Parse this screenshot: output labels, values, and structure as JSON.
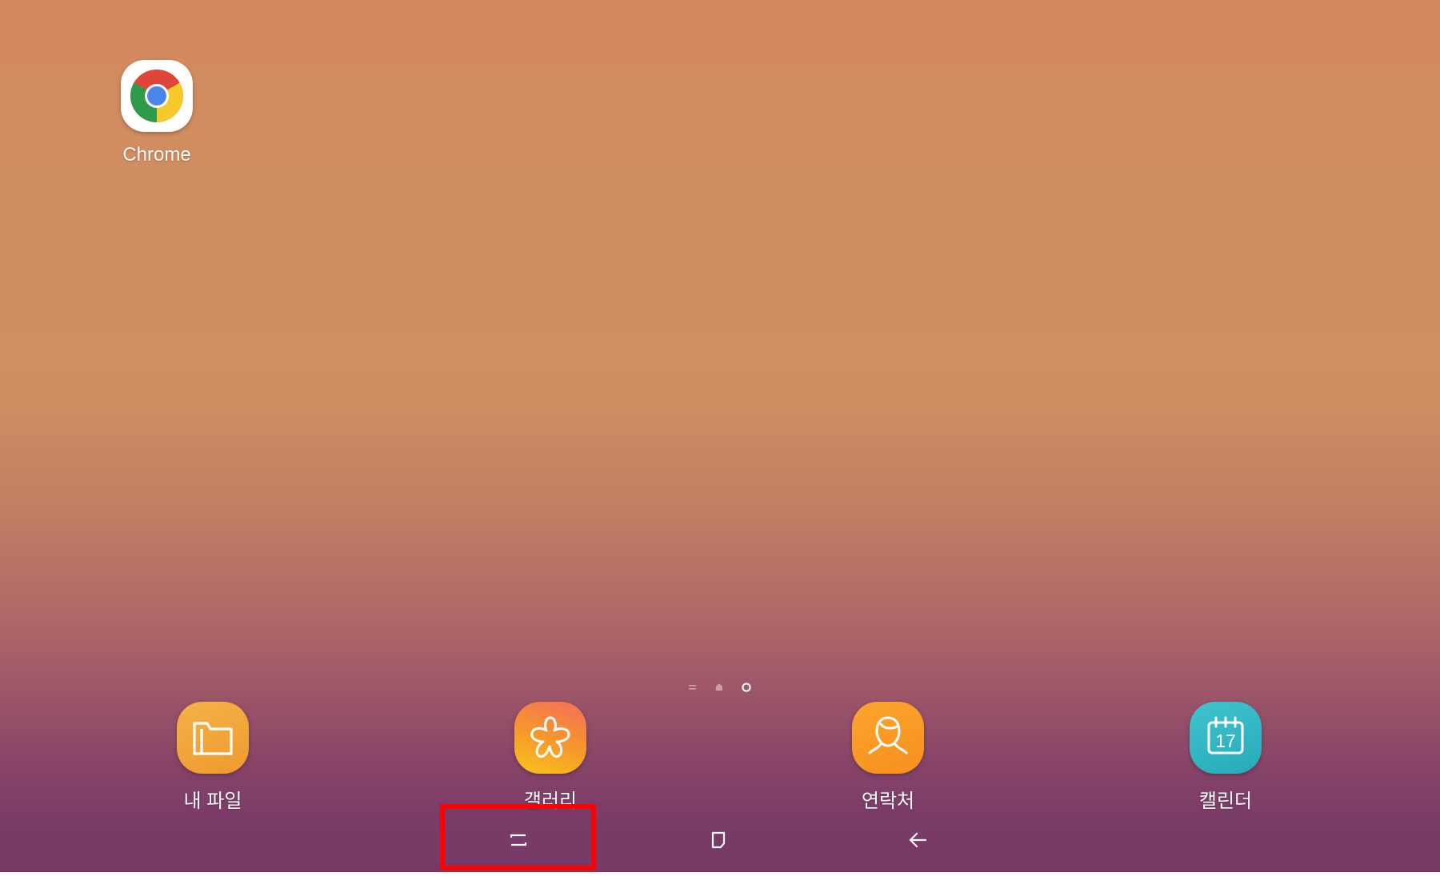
{
  "desktop": {
    "apps": [
      {
        "label": "Chrome",
        "icon": "chrome-icon"
      }
    ]
  },
  "page_indicator": {
    "pages": 3,
    "current_page": 3
  },
  "dock": {
    "apps": [
      {
        "label": "내 파일",
        "icon": "folder-icon",
        "color": "#F1A336"
      },
      {
        "label": "갤러리",
        "icon": "flower-icon",
        "color": "#F6892E"
      },
      {
        "label": "연락처",
        "icon": "person-icon",
        "color": "#F99A25"
      },
      {
        "label": "캘린더",
        "icon": "calendar-icon",
        "color": "#33B8C4",
        "icon_text": "17"
      }
    ]
  },
  "navigation_bar": {
    "buttons": [
      {
        "name": "recents",
        "icon": "recent-apps-icon"
      },
      {
        "name": "home",
        "icon": "home-icon"
      },
      {
        "name": "back",
        "icon": "back-arrow-icon"
      }
    ]
  },
  "highlight": {
    "target": "recents",
    "color": "#FF0000"
  }
}
